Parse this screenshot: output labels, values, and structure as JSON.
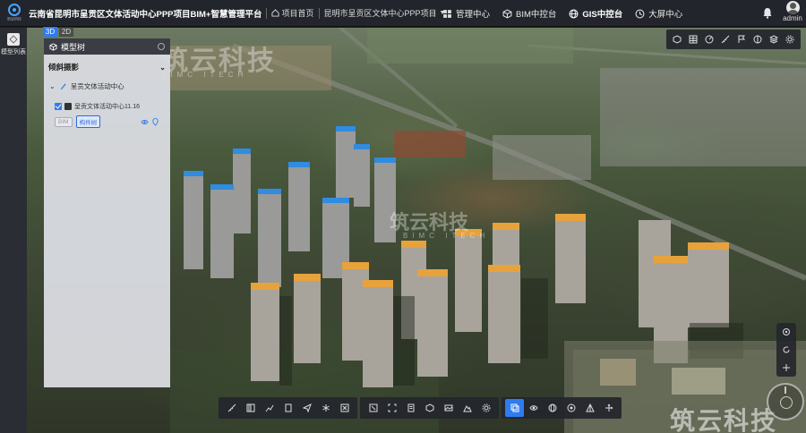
{
  "header": {
    "logo_text": "筑云科技",
    "title": "云南省昆明市呈贡区文体活动中心PPP项目BIM+智慧管理平台",
    "home_label": "项目首页",
    "project_label": "昆明市呈贡区文体中心PPP项目",
    "nav": [
      {
        "label": "管理中心",
        "icon": "grid-icon"
      },
      {
        "label": "BIM中控台",
        "icon": "cube-icon"
      },
      {
        "label": "GIS中控台",
        "icon": "globe-icon",
        "active": true
      },
      {
        "label": "大屏中心",
        "icon": "monitor-icon"
      }
    ],
    "user_name": "admin"
  },
  "left_rail": {
    "items": [
      {
        "label": "模型列表",
        "icon": "layers-icon"
      }
    ]
  },
  "view_toggle": {
    "options": [
      "3D",
      "2D"
    ],
    "selected": "3D"
  },
  "tree_panel": {
    "title": "模型树",
    "section": "倾斜摄影",
    "group": "呈贡文体活动中心",
    "model": "呈贡文体活动中心11.16",
    "tags": [
      "BIM",
      "构件树"
    ]
  },
  "watermark": {
    "text": "筑云科技",
    "sub": "BIMC ITECH"
  },
  "colors": {
    "accent": "#2f7bf0",
    "panel": "#d9dbe0",
    "bar": "#22252b"
  },
  "right_toolbar_icons": [
    "box-icon",
    "grid-table-icon",
    "compass-dial-icon",
    "ruler-icon",
    "flag-icon",
    "cube-outline-icon",
    "layers-stack-icon",
    "settings-icon"
  ],
  "bottom_toolbar_groups": [
    [
      "ruler-icon",
      "distance-icon",
      "line-chart-icon",
      "panel-icon",
      "send-icon",
      "snowflake-icon",
      "cut-icon"
    ],
    [
      "expand-icon",
      "frame-icon",
      "doc-icon",
      "box-icon",
      "photo-icon",
      "mountain-icon",
      "settings-icon"
    ],
    [
      "copy-icon",
      "eye-icon",
      "globe-icon",
      "target-icon",
      "triangle-icon",
      "move-icon"
    ]
  ]
}
